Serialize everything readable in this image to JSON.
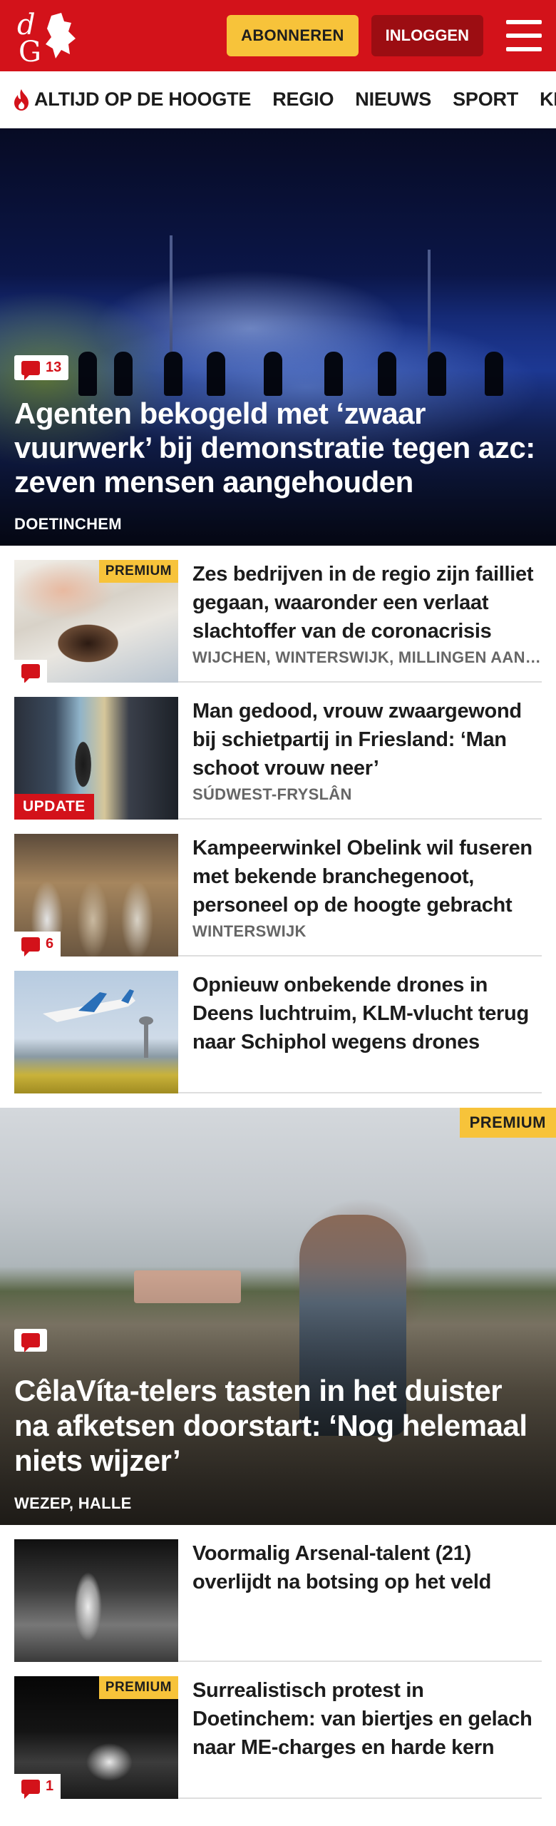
{
  "header": {
    "logo_text": "dG",
    "subscribe_label": "ABONNEREN",
    "login_label": "INLOGGEN",
    "colors": {
      "brand_red": "#d3121a",
      "subscribe_yellow": "#f7c33a",
      "login_dark_red": "#9c0d12"
    }
  },
  "nav": {
    "items": [
      {
        "label": "ALTIJD OP DE HOOGTE",
        "icon": "flame-icon"
      },
      {
        "label": "REGIO"
      },
      {
        "label": "NIEUWS"
      },
      {
        "label": "SPORT"
      },
      {
        "label": "KIJK"
      }
    ]
  },
  "hero": {
    "comments": "13",
    "title": "Agenten bekogeld met ‘zwaar vuurwerk’ bij demonstratie tegen azc: zeven mensen aangehouden",
    "location": "DOETINCHEM"
  },
  "articles": [
    {
      "title": "Zes bedrijven in de regio zijn failliet gegaan, waaronder een verlaat slachtoffer van de coronacrisis",
      "location": "WIJCHEN, WINTERSWIJK, MILLINGEN AAN DE RIJN",
      "premium": "PREMIUM",
      "comments": ""
    },
    {
      "title": "Man gedood, vrouw zwaarge­wond bij schietpartij in Friesland: ‘Man schoot vrouw neer’",
      "location": "SÚDWEST-FRYSLÂN",
      "update": "UPDATE"
    },
    {
      "title": "Kampeerwinkel Obelink wil fuseren met bekende branchege­noot, personeel op de hoogte gebracht",
      "location": "WINTERSWIJK",
      "comments": "6"
    },
    {
      "title": "Opnieuw onbekende drones in Deens luchtruim, KLM-vlucht terug naar Schiphol wegens drones",
      "location": ""
    }
  ],
  "hero2": {
    "premium": "PREMIUM",
    "comments": "",
    "title": "CêlaVíta-telers tasten in het duister na afketsen doorstart: ‘Nog helemaal niets wijzer’",
    "location": "WEZEP, HALLE"
  },
  "articles2": [
    {
      "title": "Voormalig Arsenal-talent (21) overlijdt na botsing op het veld",
      "location": ""
    },
    {
      "title": "Surrealistisch protest in Doetinchem: van biertjes en gelach naar ME-charges en harde kern",
      "location": "",
      "premium": "PREMIUM",
      "comments": "1"
    }
  ]
}
